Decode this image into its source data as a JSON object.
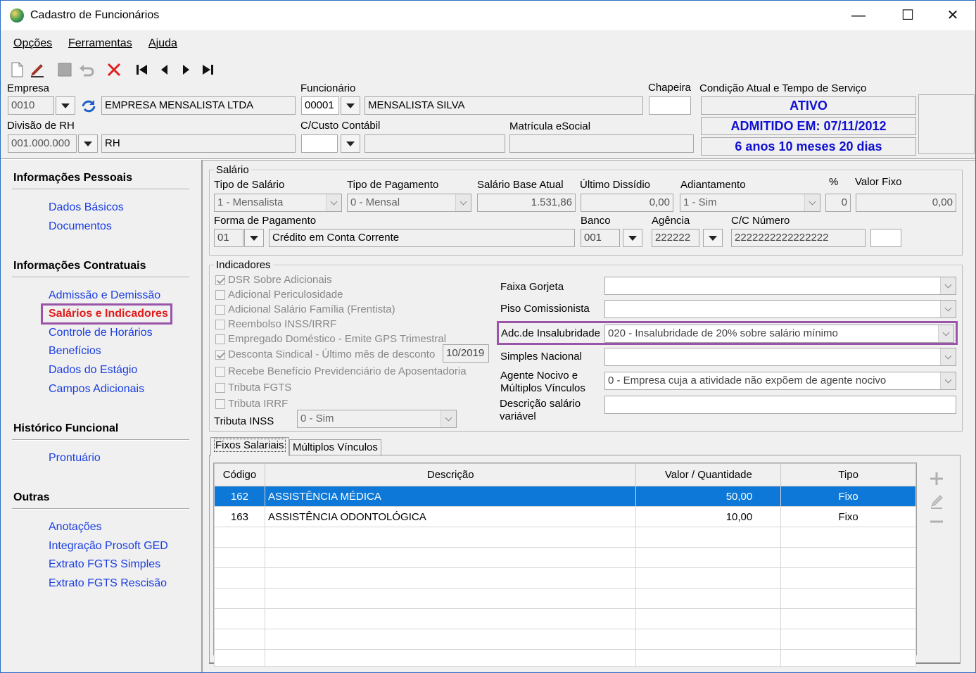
{
  "window": {
    "title": "Cadastro de Funcionários",
    "min": "—",
    "max": "☐",
    "close": "✕"
  },
  "menu": {
    "opcoes": "Opções",
    "ferramentas": "Ferramentas",
    "ajuda": "Ajuda"
  },
  "header": {
    "empresa_label": "Empresa",
    "empresa_code": "0010",
    "empresa_name": "EMPRESA MENSALISTA LTDA",
    "divisao_label": "Divisão de RH",
    "divisao_code": "001.000.000",
    "divisao_name": "RH",
    "funcionario_label": "Funcionário",
    "funcionario_code": "00001",
    "funcionario_name": "MENSALISTA SILVA",
    "ccusto_label": "C/Custo Contábil",
    "ccusto_code": "",
    "chapeira_label": "Chapeira",
    "chapeira_value": "",
    "matricula_label": "Matrícula eSocial",
    "matricula_value": "",
    "condicao_label": "Condição Atual e Tempo de Serviço",
    "status": "ATIVO",
    "admitido": "ADMITIDO EM: 07/11/2012",
    "tempo": "6 anos 10 meses 20 dias"
  },
  "nav": {
    "pessoais": "Informações Pessoais",
    "dados_basicos": "Dados Básicos",
    "documentos": "Documentos",
    "contratuais": "Informações Contratuais",
    "admissao": "Admissão e Demissão",
    "salarios": "Salários e Indicadores",
    "horarios": "Controle de Horários",
    "beneficios": "Benefícios",
    "estagio": "Dados do Estágio",
    "campos": "Campos Adicionais",
    "historico": "Histórico Funcional",
    "prontuario": "Prontuário",
    "outras": "Outras",
    "anotacoes": "Anotações",
    "integracao": "Integração Prosoft GED",
    "fgts_simples": "Extrato FGTS Simples",
    "fgts_rescisao": "Extrato FGTS Rescisão"
  },
  "salario": {
    "group": "Salário",
    "tipo_salario_label": "Tipo de Salário",
    "tipo_salario": "1 - Mensalista",
    "tipo_pagamento_label": "Tipo de Pagamento",
    "tipo_pagamento": "0 - Mensal",
    "base_label": "Salário Base Atual",
    "base": "1.531,86",
    "dissidio_label": "Último Dissídio",
    "dissidio": "0,00",
    "adiantamento_label": "Adiantamento",
    "adiantamento": "1 - Sim",
    "pct_label": "%",
    "pct": "0",
    "valor_fixo_label": "Valor Fixo",
    "valor_fixo": "0,00",
    "forma_label": "Forma de Pagamento",
    "forma_code": "01",
    "forma_desc": "Crédito em Conta Corrente",
    "banco_label": "Banco",
    "banco": "001",
    "agencia_label": "Agência",
    "agencia": "222222",
    "cc_label": "C/C Número",
    "cc": "2222222222222222",
    "cc_dv": ""
  },
  "indicadores": {
    "group": "Indicadores",
    "dsr": "DSR Sobre Adicionais",
    "periculosidade": "Adicional Periculosidade",
    "salario_familia": "Adicional Salário Família (Frentista)",
    "reembolso": "Reembolso INSS/IRRF",
    "domestico": "Empregado Doméstico - Emite GPS Trimestral",
    "sindical": "Desconta Sindical - Último mês de desconto",
    "sindical_mes": "10/2019",
    "previdenciario": "Recebe Benefício Previdenciário de Aposentadoria",
    "fgts": "Tributa FGTS",
    "irrf": "Tributa IRRF",
    "inss_label": "Tributa INSS",
    "inss": "0 - Sim",
    "faixa_label": "Faixa Gorjeta",
    "faixa": "",
    "piso_label": "Piso Comissionista",
    "piso": "",
    "insalubridade_label": "Adc.de Insalubridade",
    "insalubridade": "020 - Insalubridade de 20% sobre salário mínimo",
    "simples_label": "Simples Nacional",
    "simples": "",
    "agente_label1": "Agente Nocivo e",
    "agente_label2": "Múltiplos Vínculos",
    "agente": "0 - Empresa cuja a atividade não expõem de agente nocivo",
    "desc_label1": "Descrição salário",
    "desc_label2": "variável",
    "desc": ""
  },
  "tabs": {
    "fixos": "Fixos Salariais",
    "multiplos": "Múltiplos Vínculos"
  },
  "grid": {
    "headers": [
      "Código",
      "Descrição",
      "Valor / Quantidade",
      "Tipo"
    ],
    "rows": [
      [
        "162",
        "ASSISTÊNCIA MÉDICA",
        "50,00",
        "Fixo"
      ],
      [
        "163",
        "ASSISTÊNCIA ODONTOLÓGICA",
        "10,00",
        "Fixo"
      ]
    ]
  }
}
